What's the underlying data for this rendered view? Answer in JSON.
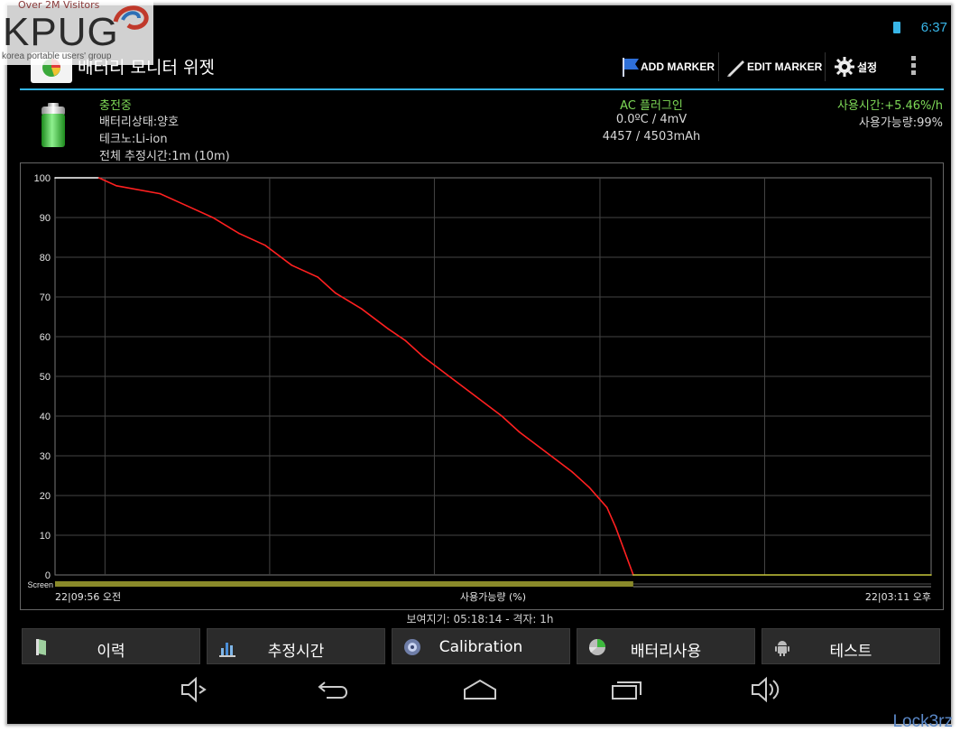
{
  "watermark": {
    "over": "Over 2M Visitors",
    "logo": "KPUG",
    "sub": "korea portable users' group",
    "signature": "Lock3rz"
  },
  "status": {
    "time": "6:37"
  },
  "action_bar": {
    "title": "배터리 모니터 위젯",
    "add_marker": "ADD MARKER",
    "edit_marker": "EDIT MARKER",
    "settings": "설정"
  },
  "info": {
    "charging": "충전중",
    "battery_health": "배터리상태:양호",
    "technology": "테크노:Li-ion",
    "total_estimate": "전체 추정시간:1m (10m)",
    "plug": "AC 플러그인",
    "temp_voltage": "0.0ºC / 4mV",
    "capacity": "4457 / 4503mAh",
    "usage_rate": "사용시간:+5.46%/h",
    "available": "사용가능량:99%"
  },
  "chart_data": {
    "type": "line",
    "yticks": [
      "100",
      "90",
      "80",
      "70",
      "60",
      "50",
      "40",
      "30",
      "20",
      "10",
      "0"
    ],
    "ylim": [
      0,
      100
    ],
    "xlabel": "사용가능량 (%)",
    "x_start_label": "22|09:56 오전",
    "x_end_label": "22|03:11 오후",
    "screen_label": "Screen",
    "grid": true,
    "series": [
      {
        "color": "#ffffff",
        "x": [
          0.0,
          0.05
        ],
        "values": [
          100,
          100
        ]
      },
      {
        "color": "#ff2020",
        "x": [
          0.05,
          0.07,
          0.12,
          0.15,
          0.18,
          0.21,
          0.24,
          0.27,
          0.3,
          0.32,
          0.35,
          0.38,
          0.4,
          0.42,
          0.45,
          0.48,
          0.51,
          0.53,
          0.56,
          0.59,
          0.61,
          0.63,
          0.64,
          0.66
        ],
        "values": [
          100,
          98,
          96,
          93,
          90,
          86,
          83,
          78,
          75,
          71,
          67,
          62,
          59,
          55,
          50,
          45,
          40,
          36,
          31,
          26,
          22,
          17,
          12,
          0
        ]
      },
      {
        "color": "#c8c83a",
        "x": [
          0.66,
          1.0
        ],
        "values": [
          0,
          0
        ]
      }
    ],
    "screen_on_fraction": 0.66
  },
  "bottom": {
    "view_info": "보여지기: 05:18:14 - 격자: 1h"
  },
  "tabs": [
    {
      "label": "이력",
      "icon": "history-icon"
    },
    {
      "label": "추정시간",
      "icon": "estimate-icon"
    },
    {
      "label": "Calibration",
      "icon": "calibration-icon"
    },
    {
      "label": "배터리사용",
      "icon": "battery-usage-icon"
    },
    {
      "label": "테스트",
      "icon": "android-icon"
    }
  ]
}
